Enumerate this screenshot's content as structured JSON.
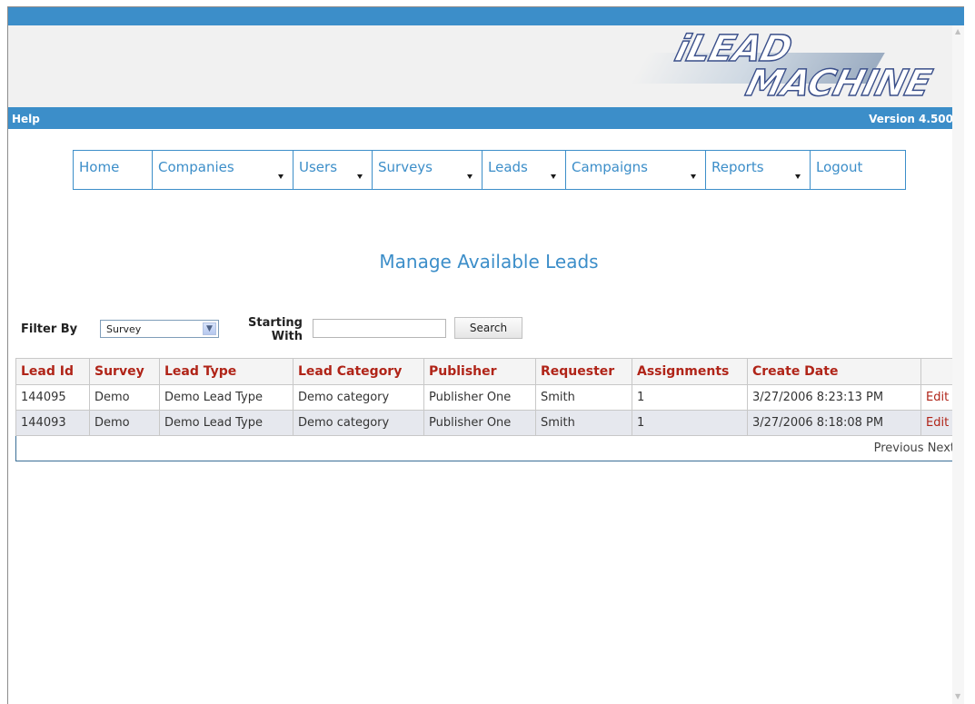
{
  "header": {
    "logo_line1": "iLEAD",
    "logo_line2": "MACHINE",
    "help_label": "Help",
    "version_label": "Version 4.500"
  },
  "nav": {
    "items": [
      {
        "label": "Home",
        "has_dropdown": false
      },
      {
        "label": "Companies",
        "has_dropdown": true
      },
      {
        "label": "Users",
        "has_dropdown": true
      },
      {
        "label": "Surveys",
        "has_dropdown": true
      },
      {
        "label": "Leads",
        "has_dropdown": true
      },
      {
        "label": "Campaigns",
        "has_dropdown": true
      },
      {
        "label": "Reports",
        "has_dropdown": true
      },
      {
        "label": "Logout",
        "has_dropdown": false
      }
    ]
  },
  "page": {
    "title": "Manage Available Leads"
  },
  "filter": {
    "label": "Filter By",
    "selected": "Survey",
    "starting_label_1": "Starting",
    "starting_label_2": "With",
    "search_value": "",
    "search_button": "Search"
  },
  "table": {
    "columns": [
      "Lead Id",
      "Survey",
      "Lead Type",
      "Lead Category",
      "Publisher",
      "Requester",
      "Assignments",
      "Create Date",
      ""
    ],
    "rows": [
      {
        "lead_id": "144095",
        "survey": "Demo",
        "lead_type": "Demo Lead Type",
        "lead_category": "Demo category",
        "publisher": "Publisher One",
        "requester": "Smith",
        "assignments": "1",
        "create_date": "3/27/2006 8:23:13 PM",
        "action": "Edit"
      },
      {
        "lead_id": "144093",
        "survey": "Demo",
        "lead_type": "Demo Lead Type",
        "lead_category": "Demo category",
        "publisher": "Publisher One",
        "requester": "Smith",
        "assignments": "1",
        "create_date": "3/27/2006 8:18:08 PM",
        "action": "Edit"
      }
    ],
    "pager_previous": "Previous",
    "pager_next": "Next"
  },
  "colors": {
    "accent": "#3c8ec9",
    "header_text": "#b02418",
    "row_alt": "#e6e8ee"
  }
}
